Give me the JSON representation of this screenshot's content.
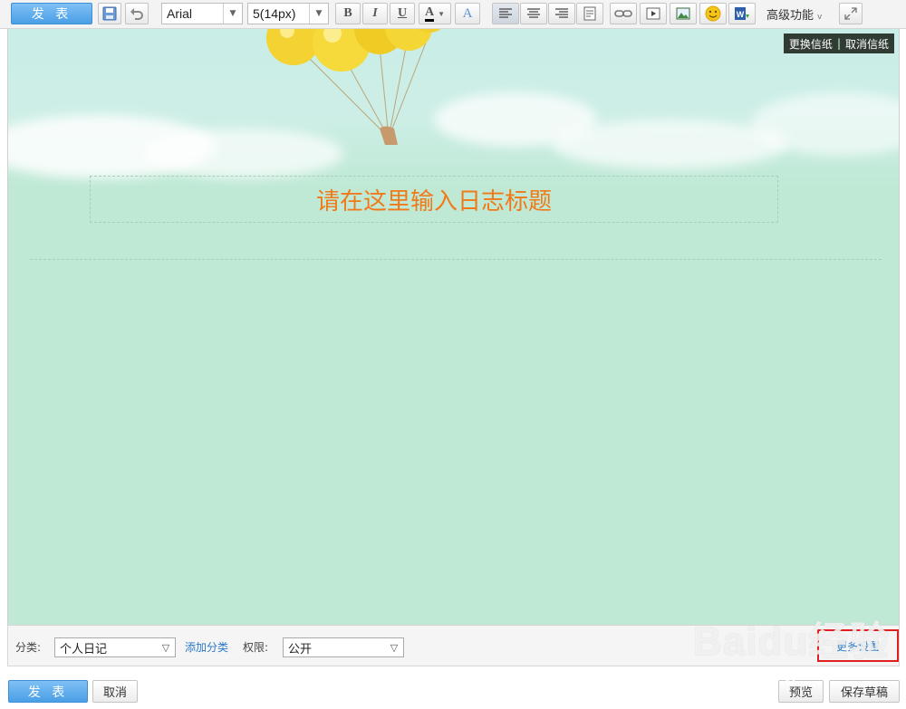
{
  "toolbar": {
    "publish_label": "发 表",
    "font_family": "Arial",
    "font_size": "5(14px)",
    "bold_label": "B",
    "italic_label": "I",
    "underline_label": "U",
    "font_color_label": "A",
    "highlight_label": "A",
    "advanced_label": "高级功能",
    "icons": [
      "save-icon",
      "undo-icon",
      "align-left-icon",
      "align-center-icon",
      "align-right-icon",
      "format-icon",
      "link-icon",
      "video-icon",
      "image-icon",
      "emoji-icon",
      "word-import-icon",
      "fullscreen-icon"
    ]
  },
  "editor": {
    "change_stationery": "更换信纸",
    "cancel_stationery": "取消信纸",
    "separator": "|",
    "title_placeholder": "请在这里输入日志标题"
  },
  "settings": {
    "category_label": "分类:",
    "category_value": "个人日记",
    "add_category": "添加分类",
    "permission_label": "权限:",
    "permission_value": "公开",
    "more_settings": "更多设置"
  },
  "footer": {
    "publish_label": "发 表",
    "cancel_label": "取消",
    "preview_label": "预览",
    "save_draft_label": "保存草稿"
  },
  "watermark": {
    "brand": "Baidu经验",
    "url": "jingyan.baidu.com"
  },
  "colors": {
    "accent_blue": "#4a9fe6",
    "editor_bg": "#bfe9d5",
    "title_orange": "#f07a1a",
    "link_blue": "#2a78c8",
    "highlight_red": "#e02020"
  }
}
